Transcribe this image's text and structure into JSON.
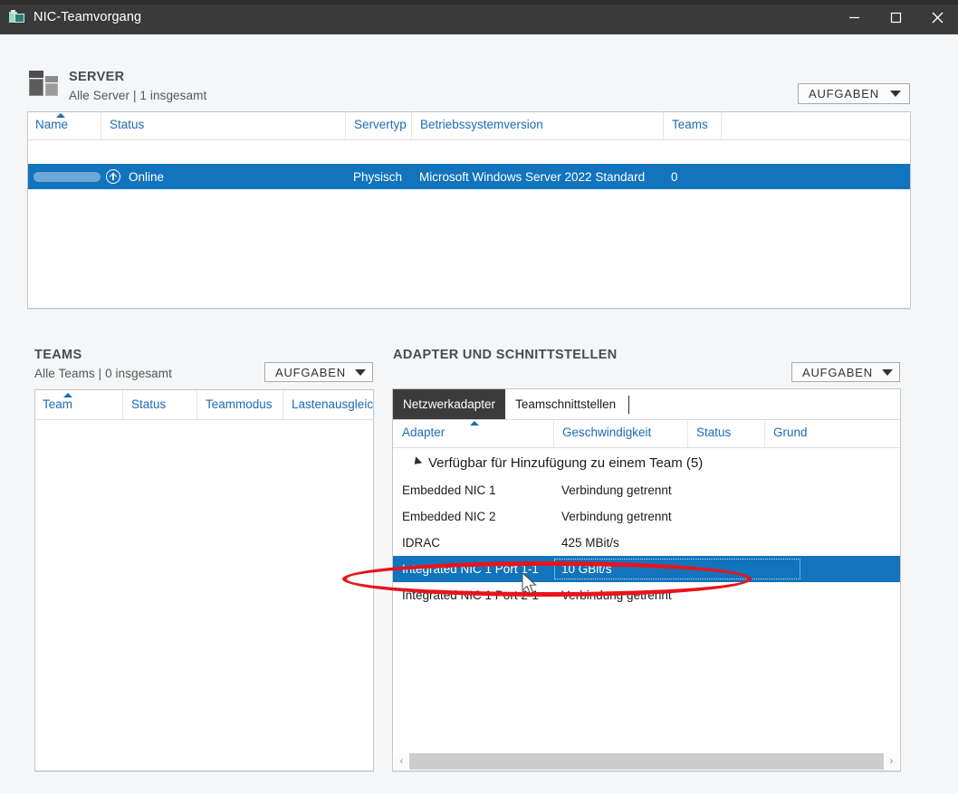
{
  "window": {
    "title": "NIC-Teamvorgang",
    "icon": "nic-teaming-icon",
    "controls": {
      "minimize": "minimize-icon",
      "maximize": "maximize-icon",
      "close": "close-icon"
    }
  },
  "server_section": {
    "title": "SERVER",
    "subtitle": "Alle Server | 1 insgesamt",
    "tasks_button": "AUFGABEN",
    "columns": [
      "Name",
      "Status",
      "Servertyp",
      "Betriebssystemversion",
      "Teams"
    ],
    "sorted_column": "Name",
    "rows": [
      {
        "name": "",
        "name_redacted": true,
        "status": "Online",
        "status_icon": "online-arrow-icon",
        "servertyp": "Physisch",
        "betriebssystemversion": "Microsoft Windows Server 2022 Standard",
        "teams": "0",
        "selected": true
      }
    ]
  },
  "teams_section": {
    "title": "TEAMS",
    "subtitle": "Alle Teams | 0 insgesamt",
    "tasks_button": "AUFGABEN",
    "columns": [
      "Team",
      "Status",
      "Teammodus",
      "Lastenausgleic"
    ],
    "sorted_column": "Team",
    "rows": []
  },
  "adapters_section": {
    "title": "ADAPTER UND SCHNITTSTELLEN",
    "tasks_button": "AUFGABEN",
    "tabs": [
      {
        "label": "Netzwerkadapter",
        "active": true
      },
      {
        "label": "Teamschnittstellen",
        "active": false
      }
    ],
    "columns": [
      "Adapter",
      "Geschwindigkeit",
      "Status",
      "Grund"
    ],
    "sorted_column": "Adapter",
    "group": {
      "label": "Verfügbar für Hinzufügung zu einem Team (5)",
      "expanded": true
    },
    "rows": [
      {
        "adapter": "Embedded NIC 1",
        "geschwindigkeit": "Verbindung getrennt",
        "status": "",
        "grund": "",
        "selected": false
      },
      {
        "adapter": "Embedded NIC 2",
        "geschwindigkeit": "Verbindung getrennt",
        "status": "",
        "grund": "",
        "selected": false
      },
      {
        "adapter": "IDRAC",
        "geschwindigkeit": "425 MBit/s",
        "status": "",
        "grund": "",
        "selected": false
      },
      {
        "adapter": "Integrated NIC 1 Port 1-1",
        "geschwindigkeit": "10 GBit/s",
        "status": "",
        "grund": "",
        "selected": true
      },
      {
        "adapter": "Integrated NIC 1 Port 2-1",
        "geschwindigkeit": "Verbindung getrennt",
        "status": "",
        "grund": "",
        "selected": false
      }
    ],
    "scrollbar": {
      "left_arrow": "‹",
      "right_arrow": "›"
    }
  },
  "annotation": {
    "shape": "ellipse",
    "color": "#e8141b",
    "target": "Integrated NIC 1 Port 1-1"
  },
  "colors": {
    "titlebar": "#3a3a3a",
    "selection_blue": "#1274bd",
    "header_link_blue": "#1d6bb5",
    "page_background": "#f5f6f8",
    "annotation_red": "#e8141b",
    "active_tab": "#3b3b3b"
  }
}
